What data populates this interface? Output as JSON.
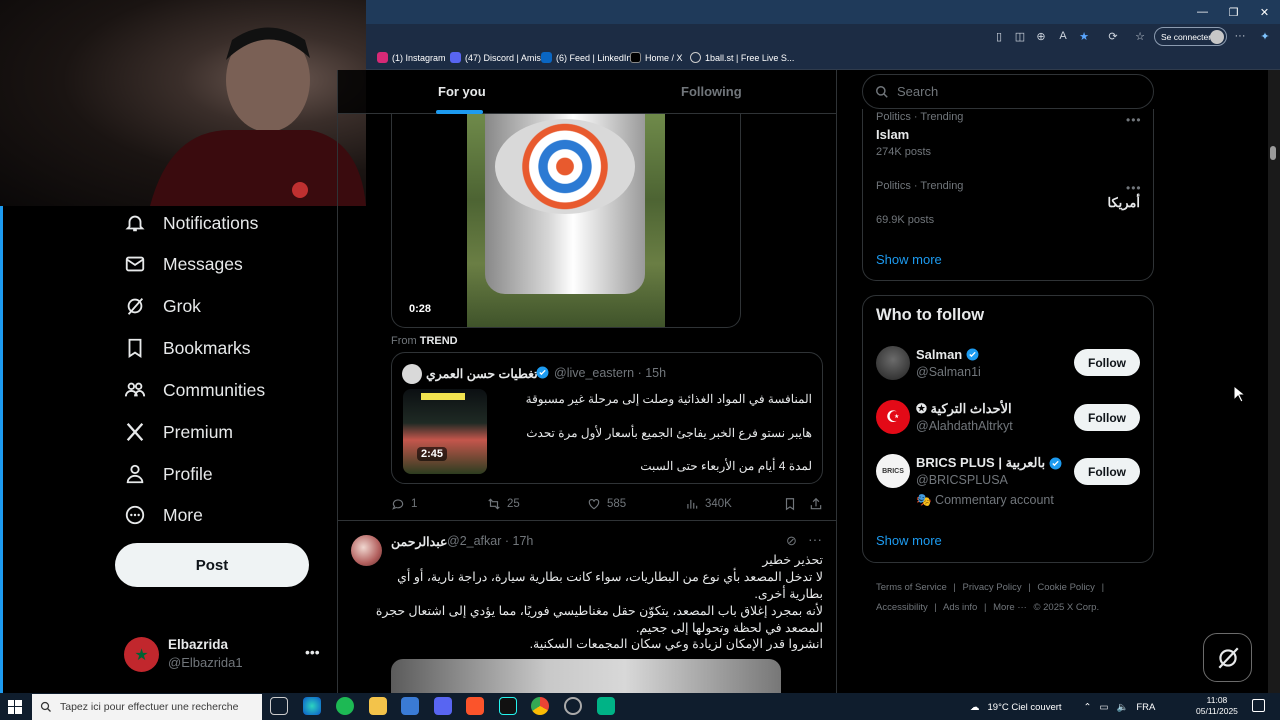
{
  "browser": {
    "signin_label": "Se connecter",
    "bookmarks": [
      "(1) Instagram",
      "(47) Discord | Amis",
      "(6) Feed | LinkedIn",
      "Home / X",
      "1ball.st | Free Live S..."
    ]
  },
  "nav": {
    "items": [
      "Notifications",
      "Messages",
      "Grok",
      "Bookmarks",
      "Communities",
      "Premium",
      "Profile",
      "More"
    ],
    "post_label": "Post",
    "account_name": "Elbazrida",
    "account_handle": "@Elbazrida1"
  },
  "tabs": {
    "for_you": "For you",
    "following": "Following"
  },
  "post1": {
    "video_time": "0:28",
    "from_label": "From",
    "from_source": "TREND",
    "quote": {
      "name": "تغطيات حسن العمري",
      "handle": "@live_eastern",
      "time": "· 15h",
      "video_time": "2:45",
      "lines": [
        "المنافسة في المواد الغذائية وصلت إلى مرحلة غير مسبوقة",
        "هايبر نستو فرع الخبر يفاجئ الجميع بأسعار لأول مرة تحدث",
        "لمدة 4 أيام من الأربعاء حتى السبت"
      ]
    },
    "stats": {
      "replies": "1",
      "reposts": "25",
      "likes": "585",
      "views": "340K"
    }
  },
  "post2": {
    "name": "عبدالرحمن",
    "handle": "@2_afkar · 17h",
    "lines": [
      "تحذير خطير",
      "لا تدخل المصعد بأي نوع من البطاريات، سواء كانت بطارية سيارة، دراجة نارية، أو أي",
      "بطارية أخرى.",
      "لأنه بمجرد إغلاق باب المصعد، يتكوّن حقل مغناطيسي فوريًا، مما يؤدي إلى اشتعال حجرة",
      "المصعد في لحظة وتحولها إلى جحيم.",
      "انشروا قدر الإمكان لزيادة وعي سكان المجمعات السكنية."
    ]
  },
  "search": {
    "placeholder": "Search"
  },
  "trends": [
    {
      "meta": "Politics · Trending",
      "name": "Islam",
      "posts": "274K posts"
    },
    {
      "meta": "Politics · Trending",
      "name": "أمريكا",
      "posts": "69.9K posts"
    }
  ],
  "trends_show_more": "Show more",
  "who_to_follow": {
    "title": "Who to follow",
    "users": [
      {
        "name": "Salman",
        "handle": "@Salman1i",
        "button": "Follow"
      },
      {
        "name": "الأحداث التركية ✪",
        "handle": "@AlahdathAltrkyt",
        "button": "Follow"
      },
      {
        "name": "BRICS PLUS | بالعربية",
        "handle": "@BRICSPLUSA",
        "note": "🎭 Commentary account",
        "button": "Follow"
      }
    ],
    "show_more": "Show more"
  },
  "footer": {
    "links": [
      "Terms of Service",
      "|",
      "Privacy Policy",
      "|",
      "Cookie Policy",
      "|",
      "Accessibility",
      "|",
      "Ads info",
      "|",
      "More ···",
      "© 2025 X Corp."
    ]
  },
  "taskbar": {
    "search_placeholder": "Tapez ici pour effectuer une recherche",
    "weather": "19°C  Ciel couvert",
    "lang": "FRA",
    "time": "11:08",
    "date": "05/11/2025"
  },
  "colors": {
    "accent": "#1d9bf0",
    "bg": "#000000",
    "text": "#e7e9ea",
    "muted": "#71767b",
    "border": "#2f3336"
  }
}
